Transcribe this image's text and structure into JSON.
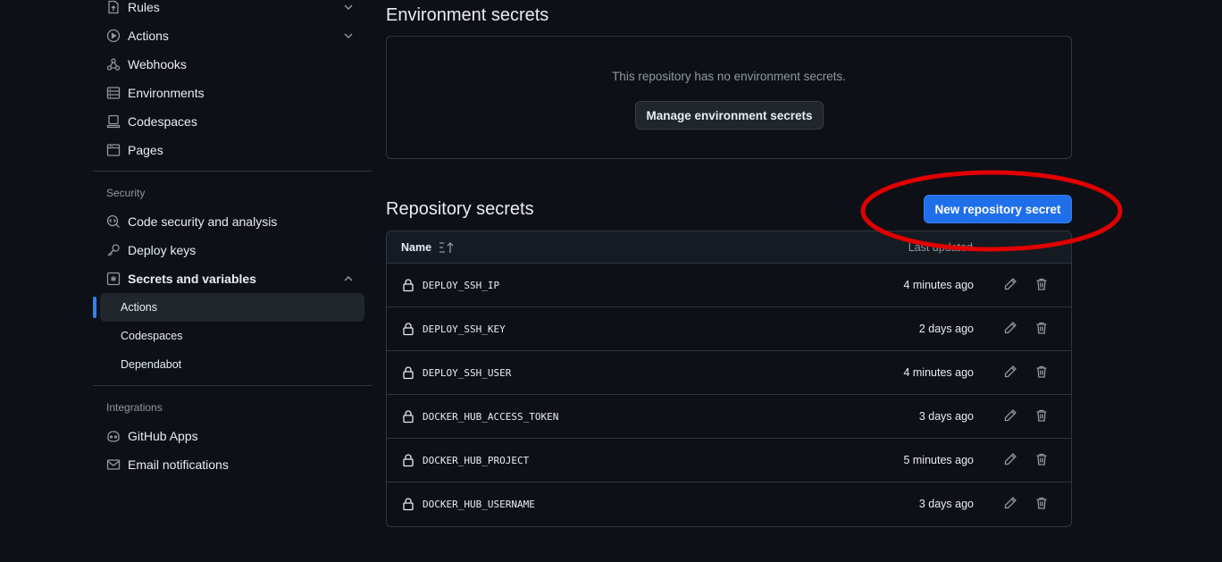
{
  "sidebar": {
    "items_top": [
      {
        "label": "Rules",
        "icon": "rules-icon",
        "chevron": "down"
      },
      {
        "label": "Actions",
        "icon": "play-icon",
        "chevron": "down"
      },
      {
        "label": "Webhooks",
        "icon": "webhook-icon"
      },
      {
        "label": "Environments",
        "icon": "server-icon"
      },
      {
        "label": "Codespaces",
        "icon": "codespaces-icon"
      },
      {
        "label": "Pages",
        "icon": "browser-icon"
      }
    ],
    "security_heading": "Security",
    "security_items": [
      {
        "label": "Code security and analysis",
        "icon": "codescan-icon"
      },
      {
        "label": "Deploy keys",
        "icon": "key-icon"
      },
      {
        "label": "Secrets and variables",
        "icon": "asterisk-icon",
        "chevron": "up"
      }
    ],
    "sub_items": [
      {
        "label": "Actions",
        "active": true
      },
      {
        "label": "Codespaces"
      },
      {
        "label": "Dependabot"
      }
    ],
    "integrations_heading": "Integrations",
    "integration_items": [
      {
        "label": "GitHub Apps",
        "icon": "copilot-icon"
      },
      {
        "label": "Email notifications",
        "icon": "mail-icon"
      }
    ]
  },
  "environment": {
    "title": "Environment secrets",
    "empty_text": "This repository has no environment secrets.",
    "manage_button": "Manage environment secrets"
  },
  "repository": {
    "title": "Repository secrets",
    "new_button": "New repository secret",
    "columns": {
      "name": "Name",
      "updated": "Last updated"
    },
    "secrets": [
      {
        "name": "DEPLOY_SSH_IP",
        "updated": "4 minutes ago"
      },
      {
        "name": "DEPLOY_SSH_KEY",
        "updated": "2 days ago"
      },
      {
        "name": "DEPLOY_SSH_USER",
        "updated": "4 minutes ago"
      },
      {
        "name": "DOCKER_HUB_ACCESS_TOKEN",
        "updated": "3 days ago"
      },
      {
        "name": "DOCKER_HUB_PROJECT",
        "updated": "5 minutes ago"
      },
      {
        "name": "DOCKER_HUB_USERNAME",
        "updated": "3 days ago"
      }
    ]
  },
  "colors": {
    "background": "#0d1117",
    "border": "#30363d",
    "primary": "#1f6feb",
    "annotation": "#e00000"
  }
}
